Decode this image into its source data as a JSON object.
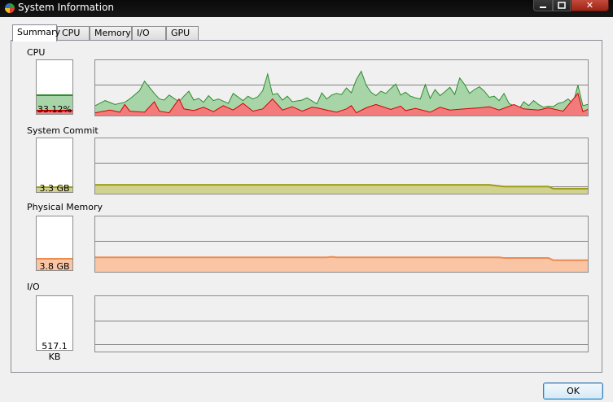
{
  "window": {
    "title": "System Information",
    "close_glyph": "✕"
  },
  "tabs": [
    {
      "label": "Summary",
      "active": true
    },
    {
      "label": "CPU",
      "active": false
    },
    {
      "label": "Memory",
      "active": false
    },
    {
      "label": "I/O",
      "active": false
    },
    {
      "label": "GPU",
      "active": false
    }
  ],
  "sections": {
    "cpu": {
      "label": "CPU",
      "value": "33.12%",
      "meter_total_fraction": 0.33,
      "meter_kernel_fraction": 0.04
    },
    "commit": {
      "label": "System Commit",
      "value": "3.3 GB",
      "meter_fraction": 0.07
    },
    "physical": {
      "label": "Physical Memory",
      "value": "3.8 GB",
      "meter_fraction": 0.2
    },
    "io": {
      "label": "I/O",
      "value": "517.1  KB",
      "meter_fraction": 0.0
    }
  },
  "buttons": {
    "ok": "OK"
  },
  "colors": {
    "cpu_total_fill": "#a8d5a8",
    "cpu_total_line": "#2e8b2e",
    "cpu_kernel_fill": "#f27c7c",
    "cpu_kernel_line": "#d40000",
    "commit_fill": "#d2d28f",
    "commit_line": "#9c9c1c",
    "physical_fill": "#f9c5a4",
    "physical_line": "#ef8a4f",
    "grid": "#808080"
  },
  "chart_data": [
    {
      "type": "area",
      "name": "cpu-history",
      "ylim": [
        0,
        100
      ],
      "xlim": [
        0,
        100
      ],
      "grid": true,
      "series": [
        {
          "x": [
            0,
            2,
            4,
            6,
            7,
            9,
            10,
            12,
            13,
            14,
            15,
            17,
            18,
            19,
            20,
            21,
            22,
            23,
            24,
            25,
            27,
            28,
            30,
            31,
            32,
            33,
            34,
            35,
            36,
            37,
            38,
            39,
            40,
            42,
            43,
            45,
            46,
            47,
            48,
            49,
            50,
            51,
            52,
            53,
            54,
            55,
            56,
            57,
            58,
            59,
            60,
            61,
            62,
            63,
            64,
            65,
            66,
            67,
            68,
            69,
            70,
            71,
            72,
            73,
            74,
            75,
            76,
            77,
            78,
            79,
            80,
            81,
            82,
            83,
            84,
            85,
            86,
            87,
            88,
            89,
            90,
            91,
            92,
            93,
            94,
            95,
            96,
            97,
            98,
            99,
            100
          ],
          "values": [
            18,
            27,
            20,
            24,
            30,
            45,
            62,
            40,
            30,
            28,
            37,
            25,
            35,
            44,
            28,
            31,
            24,
            36,
            27,
            30,
            22,
            40,
            27,
            35,
            30,
            34,
            45,
            75,
            38,
            40,
            28,
            35,
            25,
            28,
            32,
            21,
            41,
            30,
            37,
            40,
            38,
            50,
            41,
            65,
            80,
            55,
            42,
            36,
            44,
            40,
            49,
            57,
            37,
            42,
            35,
            32,
            30,
            56,
            31,
            47,
            36,
            43,
            51,
            38,
            68,
            56,
            40,
            47,
            52,
            44,
            33,
            35,
            27,
            40,
            22,
            17,
            11,
            25,
            18,
            27,
            20,
            15,
            17,
            16,
            22,
            24,
            30,
            22,
            55,
            18,
            20
          ]
        },
        {
          "x": [
            0,
            3,
            5,
            6,
            7,
            10,
            12,
            13,
            15,
            17,
            18,
            20,
            22,
            24,
            26,
            28,
            30,
            32,
            34,
            36,
            38,
            40,
            42,
            44,
            45,
            47,
            49,
            51,
            52,
            53,
            55,
            57,
            60,
            62,
            63,
            65,
            68,
            70,
            72,
            75,
            78,
            80,
            82,
            85,
            87,
            90,
            92,
            95,
            98,
            99,
            100
          ],
          "values": [
            5,
            10,
            6,
            20,
            8,
            6,
            25,
            8,
            5,
            30,
            12,
            9,
            15,
            7,
            18,
            10,
            22,
            8,
            12,
            30,
            10,
            16,
            8,
            15,
            14,
            10,
            6,
            12,
            18,
            5,
            14,
            20,
            11,
            17,
            9,
            13,
            6,
            15,
            10,
            12,
            14,
            16,
            10,
            20,
            12,
            10,
            14,
            8,
            40,
            7,
            11
          ]
        }
      ]
    },
    {
      "type": "area",
      "name": "commit-history",
      "ylim": [
        0,
        100
      ],
      "xlim": [
        0,
        100
      ],
      "grid": true,
      "series": [
        {
          "x": [
            0,
            80,
            83,
            92,
            93,
            100
          ],
          "values": [
            16,
            16,
            13,
            13,
            9,
            9
          ]
        }
      ]
    },
    {
      "type": "area",
      "name": "physical-history",
      "ylim": [
        0,
        100
      ],
      "xlim": [
        0,
        100
      ],
      "grid": true,
      "series": [
        {
          "x": [
            0,
            47,
            48,
            49,
            82,
            83,
            92,
            93,
            100
          ],
          "values": [
            26,
            26,
            27,
            26,
            26,
            25,
            25,
            21,
            21
          ]
        }
      ]
    },
    {
      "type": "area",
      "name": "io-history",
      "ylim": [
        0,
        100
      ],
      "xlim": [
        0,
        100
      ],
      "grid": true,
      "series": [
        {
          "x": [
            0,
            100
          ],
          "values": [
            0,
            0
          ]
        }
      ]
    }
  ]
}
